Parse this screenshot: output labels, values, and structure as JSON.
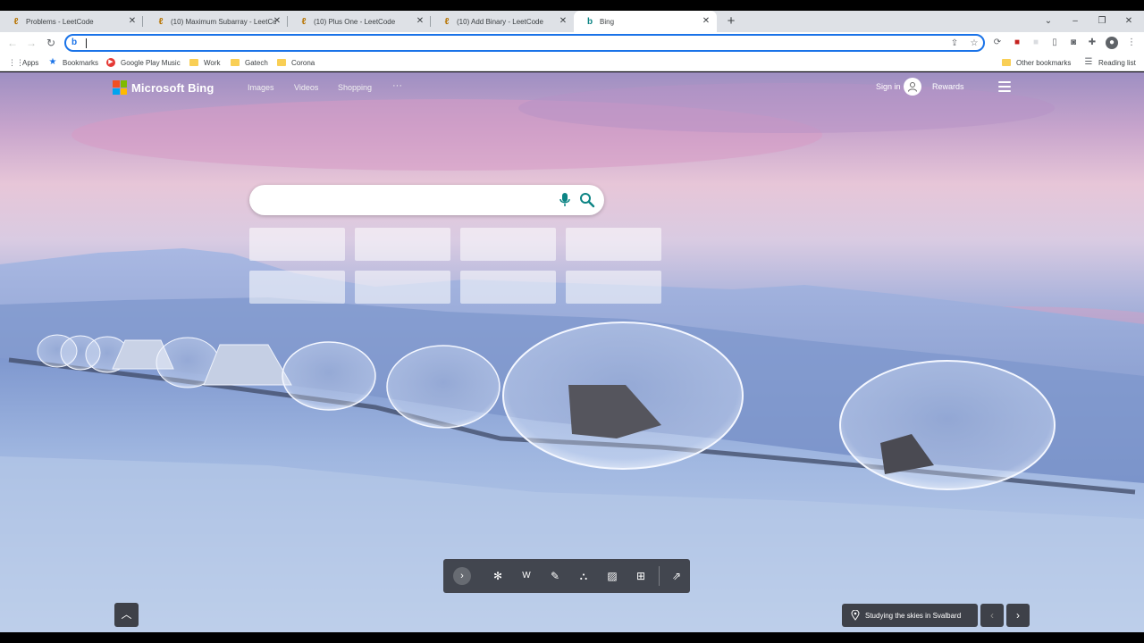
{
  "browser": {
    "tabs": [
      {
        "title": "Problems - LeetCode",
        "active": false
      },
      {
        "title": "(10) Maximum Subarray - LeetCode",
        "active": false
      },
      {
        "title": "(10) Plus One - LeetCode",
        "active": false
      },
      {
        "title": "(10) Add Binary - LeetCode",
        "active": false
      },
      {
        "title": "Bing",
        "active": true
      }
    ],
    "new_tab_symbol": "+",
    "address": {
      "value": "",
      "placeholder": ""
    },
    "bookmarks": [
      {
        "label": "Apps",
        "icon": "apps-grid-icon"
      },
      {
        "label": "Bookmarks",
        "icon": "star-icon"
      },
      {
        "label": "Google Play Music",
        "icon": "play-music-icon"
      },
      {
        "label": "Work",
        "icon": "folder-icon"
      },
      {
        "label": "Gatech",
        "icon": "folder-icon"
      },
      {
        "label": "Corona",
        "icon": "folder-icon"
      }
    ],
    "other_bookmarks": "Other bookmarks",
    "reading_list": "Reading list"
  },
  "bing": {
    "brand": "Microsoft Bing",
    "nav": [
      "Images",
      "Videos",
      "Shopping"
    ],
    "more": "···",
    "sign_in": "Sign in",
    "rewards": "Rewards",
    "search": {
      "value": "",
      "placeholder": ""
    },
    "tiles_rows": 2,
    "tiles_cols": 4,
    "image_caption": "Studying the skies in Svalbard",
    "bottom_icons": [
      "snowflake-icon",
      "weather-icon",
      "pencil-icon",
      "tree-icon",
      "pattern-icon",
      "gift-icon",
      "share-icon"
    ]
  },
  "colors": {
    "accent": "#1a73e8",
    "bing_teal": "#0c8484",
    "ms_red": "#f25022",
    "ms_green": "#7fba00",
    "ms_blue": "#00a4ef",
    "ms_yellow": "#ffb900"
  }
}
